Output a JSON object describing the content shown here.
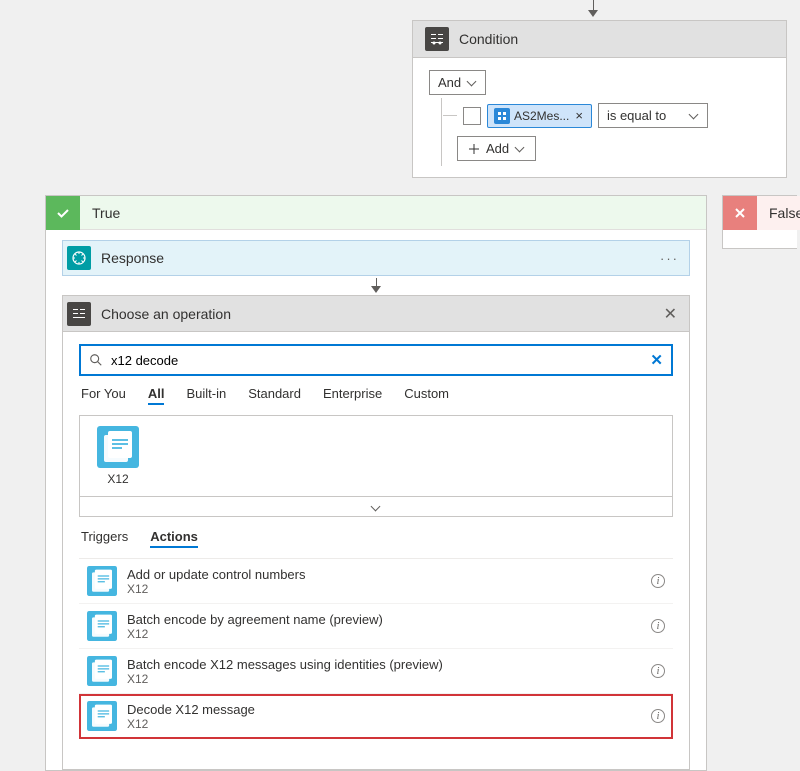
{
  "condition": {
    "title": "Condition",
    "and_label": "And",
    "token_label": "AS2Mes...",
    "operator": "is equal to",
    "add_label": "Add"
  },
  "branches": {
    "true_label": "True",
    "false_label": "False"
  },
  "response": {
    "title": "Response"
  },
  "operation_picker": {
    "title": "Choose an operation",
    "search_value": "x12 decode",
    "category_tabs": [
      "For You",
      "All",
      "Built-in",
      "Standard",
      "Enterprise",
      "Custom"
    ],
    "category_active": "All",
    "connector_label": "X12",
    "ta_tabs": [
      "Triggers",
      "Actions"
    ],
    "ta_active": "Actions",
    "actions": [
      {
        "title": "Add or update control numbers",
        "sub": "X12",
        "highlight": false
      },
      {
        "title": "Batch encode by agreement name (preview)",
        "sub": "X12",
        "highlight": false
      },
      {
        "title": "Batch encode X12 messages using identities (preview)",
        "sub": "X12",
        "highlight": false
      },
      {
        "title": "Decode X12 message",
        "sub": "X12",
        "highlight": true
      }
    ]
  }
}
